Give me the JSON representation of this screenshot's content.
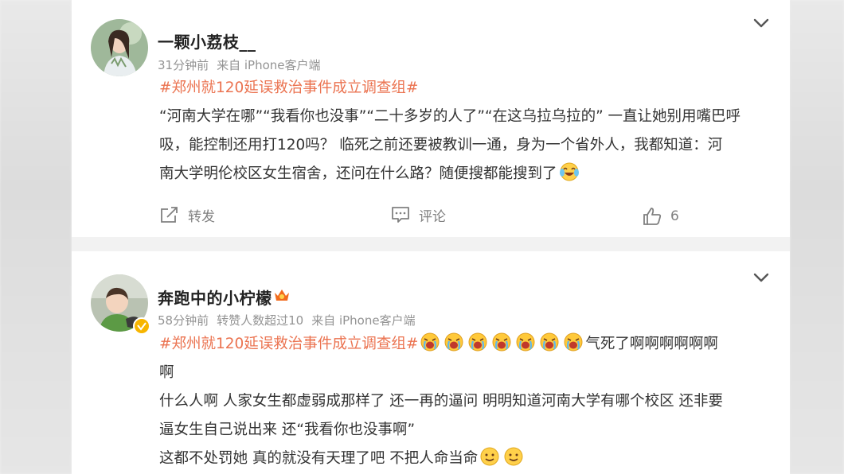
{
  "posts": [
    {
      "username": "一颗小荔枝__",
      "time": "31分钟前",
      "source": "来自 iPhone客户端",
      "hashtag": "#郑州就120延误救治事件成立调查组#",
      "lines": [
        "“河南大学在哪”“我看你也没事”“二十多岁的人了”“在这乌拉乌拉的” 一直让她别用嘴巴呼",
        "吸，能控制还用打120吗？ 临死之前还要被教训一通，身为一个省外人，我都知道：河",
        "南大学明伦校区女生宿舍，还问在什么路？随便搜都能搜到了"
      ],
      "actions": {
        "repost": "转发",
        "comment": "评论",
        "like_count": "6"
      }
    },
    {
      "username": "奔跑中的小柠檬",
      "time": "58分钟前",
      "repost_info": "转赞人数超过10",
      "source": "来自 iPhone客户端",
      "hashtag": "#郑州就120延误救治事件成立调查组#",
      "tail_text": "气死了啊啊啊啊啊啊",
      "lines": [
        "啊",
        "什么人啊 人家女生都虚弱成那样了 还一再的逼问 明明知道河南大学有哪个校区 还非要",
        "逼女生自己说出来 还“我看你也没事啊”",
        "这都不处罚她 真的就没有天理了吧 不把人命当命"
      ]
    }
  ],
  "colors": {
    "accent": "#eb7350",
    "text": "#333333",
    "meta": "#939393"
  },
  "icons": [
    "chevron-down-icon",
    "repost-icon",
    "comment-icon",
    "like-icon",
    "laugh-cry-emoji",
    "crying-emoji",
    "smile-emoji",
    "crown-badge-icon",
    "verified-badge-icon"
  ]
}
